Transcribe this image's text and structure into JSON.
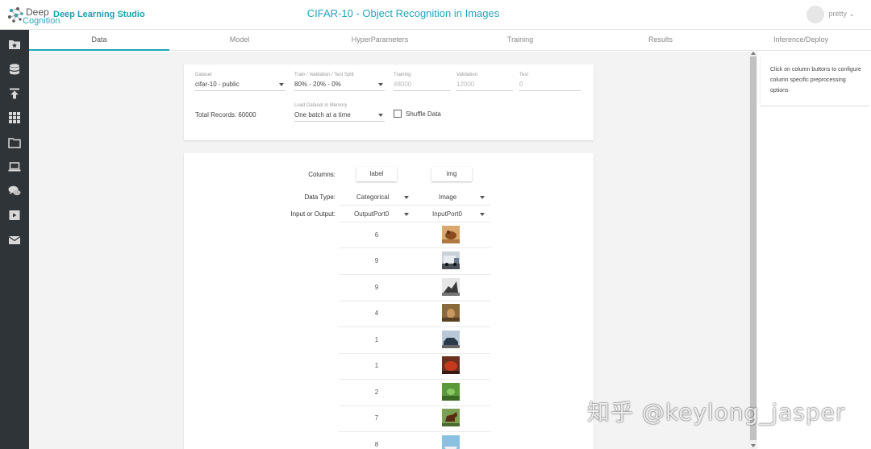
{
  "header": {
    "logo_top": "Deep",
    "logo_bottom": "Cognition",
    "studio_name": "Deep Learning Studio",
    "title": "CIFAR-10 - Object Recognition in Images",
    "username": "pretty ⌄"
  },
  "sidebar": {
    "icons": [
      "folder-star-icon",
      "database-icon",
      "upload-icon",
      "grid-icon",
      "folder-icon",
      "laptop-icon",
      "chat-icon",
      "video-icon",
      "mail-icon"
    ]
  },
  "tabs": [
    "Data",
    "Model",
    "HyperParameters",
    "Training",
    "Results",
    "Inference/Deploy"
  ],
  "dataset_card": {
    "dataset_label": "Dataset",
    "dataset_value": "cifar-10 - public",
    "split_label": "Train / Validation / Test Split",
    "split_value": "80% - 20% - 0%",
    "training_label": "Training",
    "training_value": "48000",
    "validation_label": "Validation",
    "validation_value": "12000",
    "test_label": "Test",
    "test_value": "0",
    "total_records": "Total Records: 60000",
    "load_label": "Load Dataset in Memory",
    "load_value": "One batch at a time",
    "shuffle_label": "Shuffle Data"
  },
  "columns_card": {
    "columns_label": "Columns:",
    "datatype_label": "Data Type:",
    "io_label": "Input or Output:",
    "columns": [
      {
        "name": "label",
        "data_type": "Categorical",
        "io": "OutputPort0"
      },
      {
        "name": "img",
        "data_type": "Image",
        "io": "InputPort0"
      }
    ],
    "rows": [
      {
        "label": "6",
        "thumb": "frog"
      },
      {
        "label": "9",
        "thumb": "truck"
      },
      {
        "label": "9",
        "thumb": "truck-dark"
      },
      {
        "label": "4",
        "thumb": "deer"
      },
      {
        "label": "1",
        "thumb": "automobile"
      },
      {
        "label": "1",
        "thumb": "automobile-red"
      },
      {
        "label": "2",
        "thumb": "bird"
      },
      {
        "label": "7",
        "thumb": "horse"
      },
      {
        "label": "8",
        "thumb": "ship"
      }
    ]
  },
  "right_panel": {
    "help": "Click on column buttons to configure column specific preprocessing options"
  },
  "watermark": "知乎 @keylong_jasper",
  "colors": {
    "accent": "#1ea7b8",
    "sidebar": "#2f3438",
    "background": "#f3f3f3"
  }
}
